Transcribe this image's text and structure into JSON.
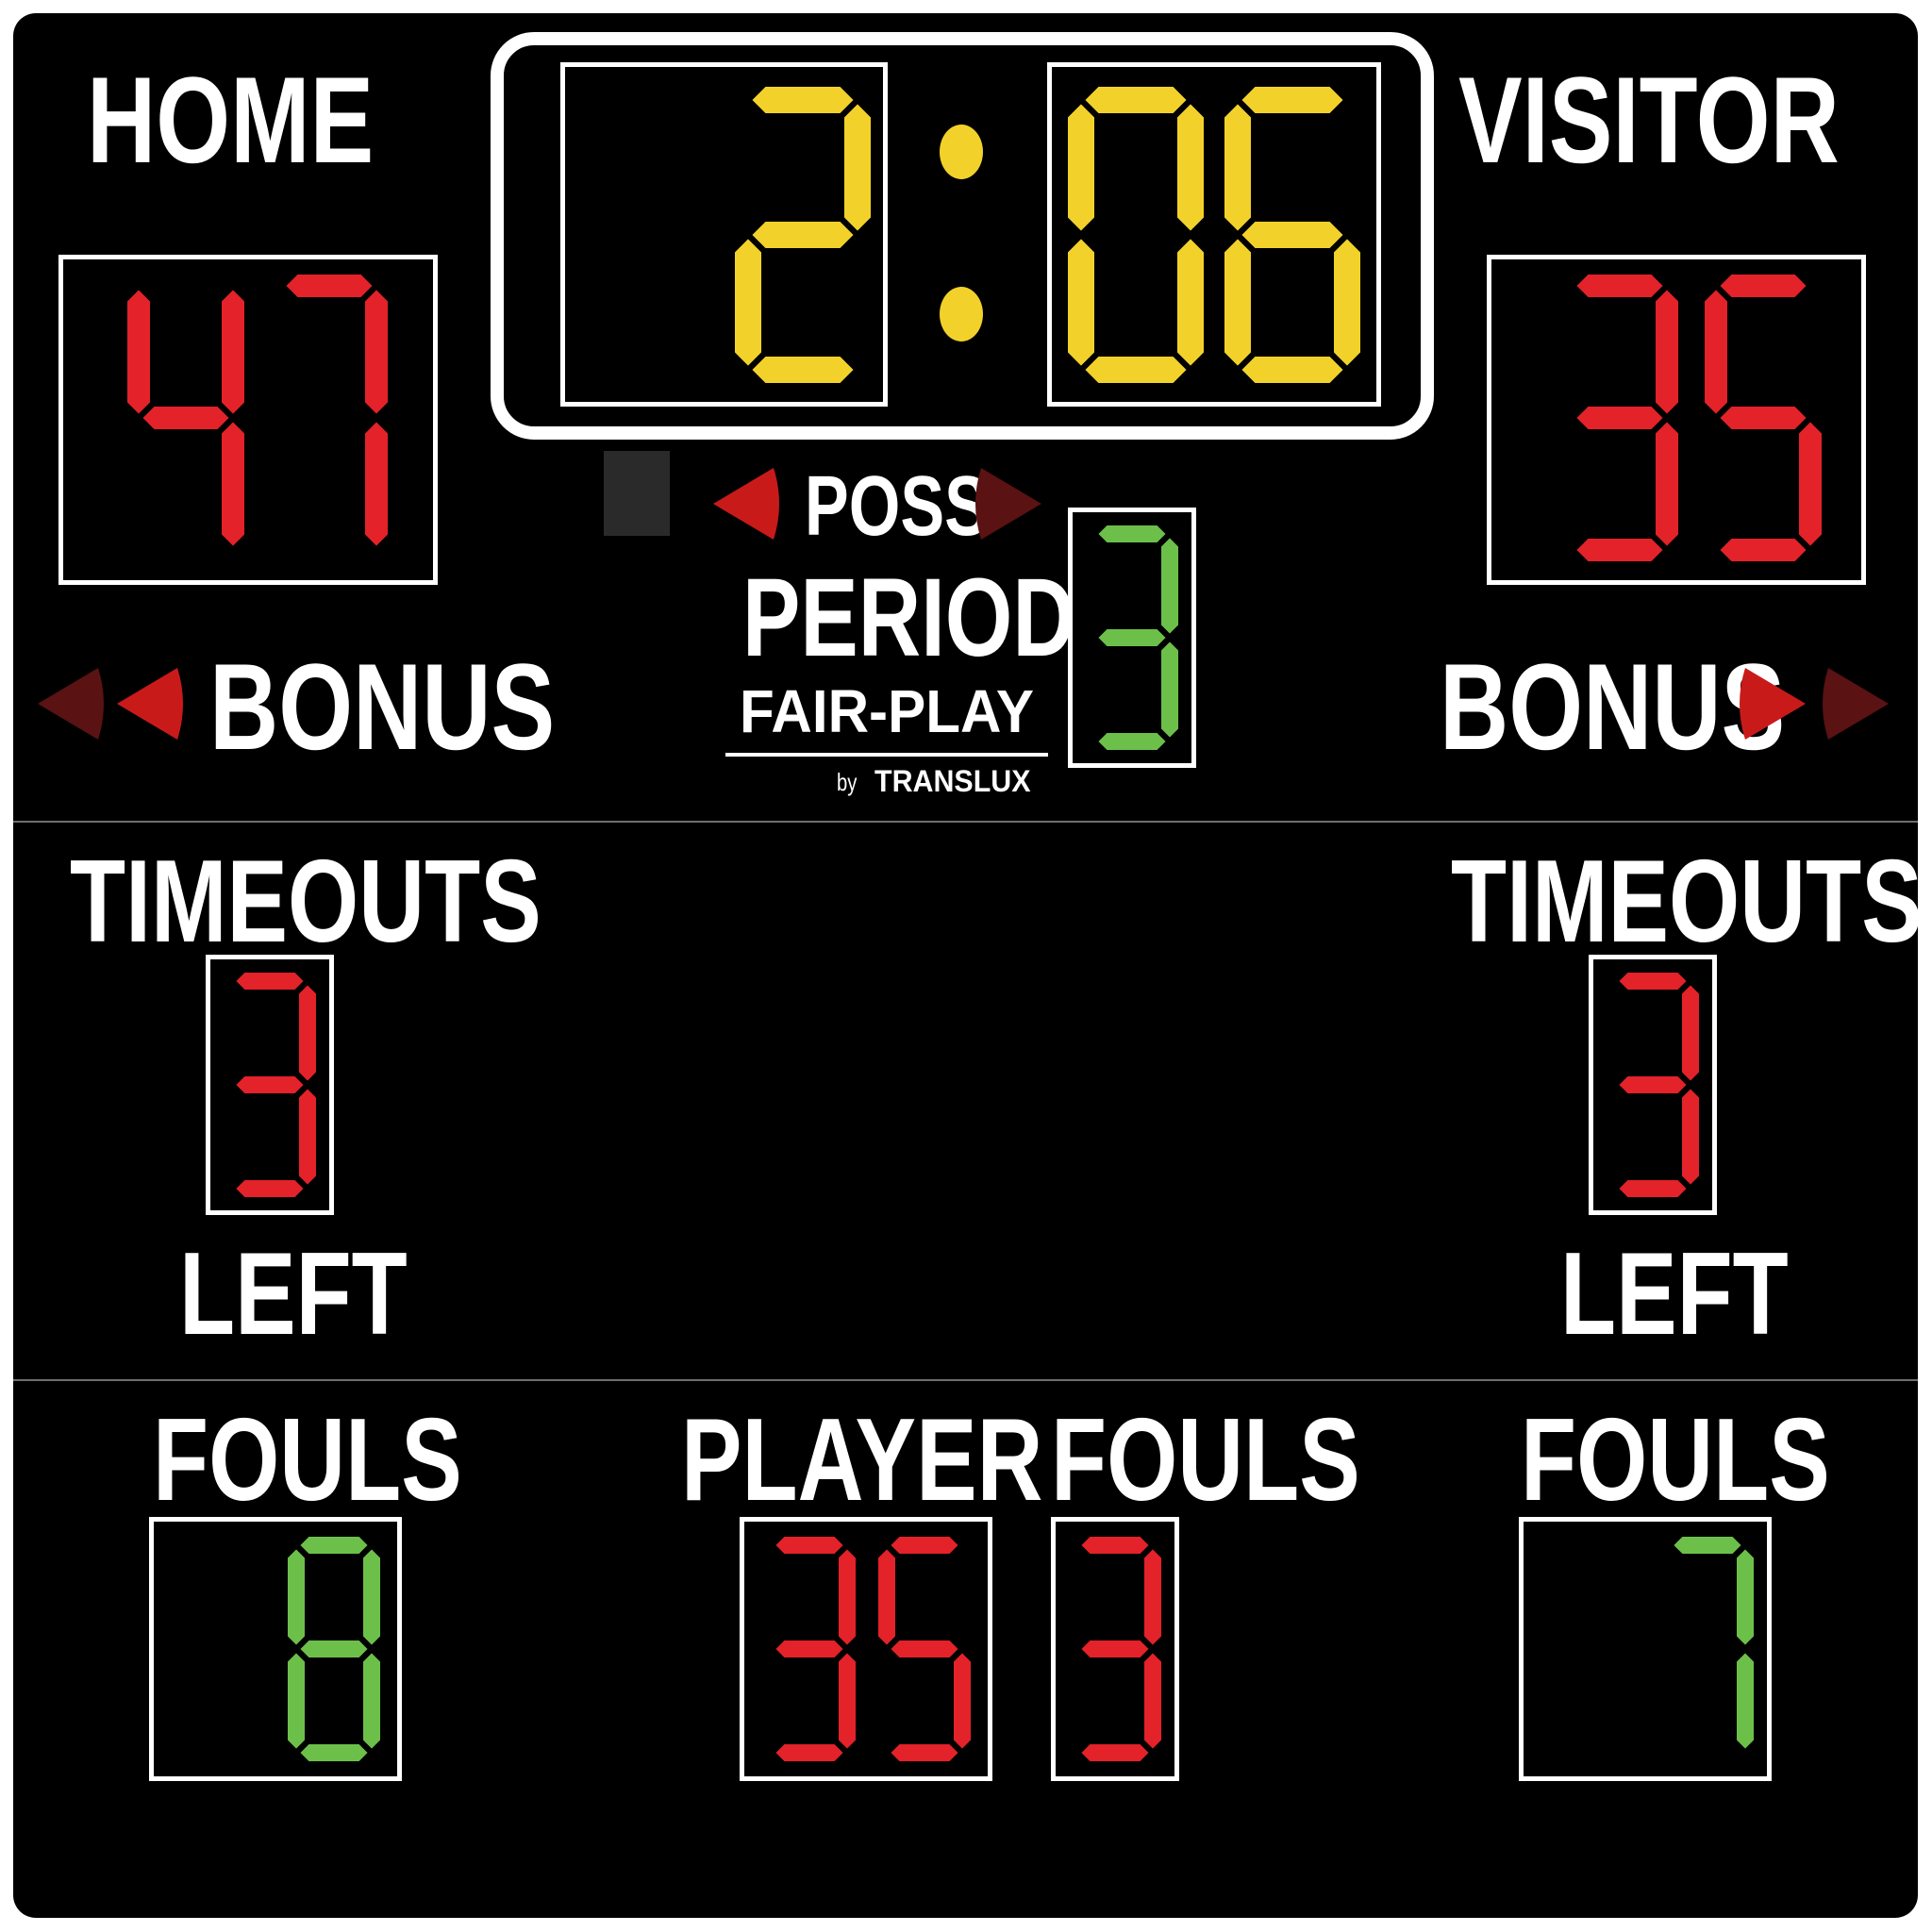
{
  "labels": {
    "home": "HOME",
    "visitor": "VISITOR",
    "bonus_home": "BONUS",
    "bonus_visitor": "BONUS",
    "poss": "POSS",
    "period": "PERIOD",
    "brand": "FAIR-PLAY",
    "brand_by": "by",
    "brand_maker": "TRANSLUX",
    "timeouts_home": "TIMEOUTS",
    "timeouts_visitor": "TIMEOUTS",
    "left_home": "LEFT",
    "left_visitor": "LEFT",
    "fouls_home": "FOULS",
    "fouls_visitor": "FOULS",
    "player": "PLAYER",
    "player_fouls": "FOULS"
  },
  "values": {
    "clock_minutes": "2",
    "clock_seconds": "06",
    "home_score": "47",
    "visitor_score": "35",
    "period": "3",
    "home_timeouts_left": "3",
    "visitor_timeouts_left": "3",
    "home_fouls": "8",
    "visitor_fouls": "7",
    "player_number": "35",
    "player_fouls": "3"
  },
  "indicators": {
    "possession": "home",
    "home_bonus_arrows_lit": 1,
    "visitor_bonus_arrows_lit": 1
  },
  "colors": {
    "board": "#000000",
    "label_text": "#ffffff",
    "score_red": "#e32229",
    "clock_yellow": "#f2d22a",
    "period_green": "#6cc04a",
    "arrow_lit": "#c91a1a",
    "arrow_dim": "#5a1212",
    "horn_light": "#2a2a2a",
    "divider": "#6e6e6e"
  }
}
